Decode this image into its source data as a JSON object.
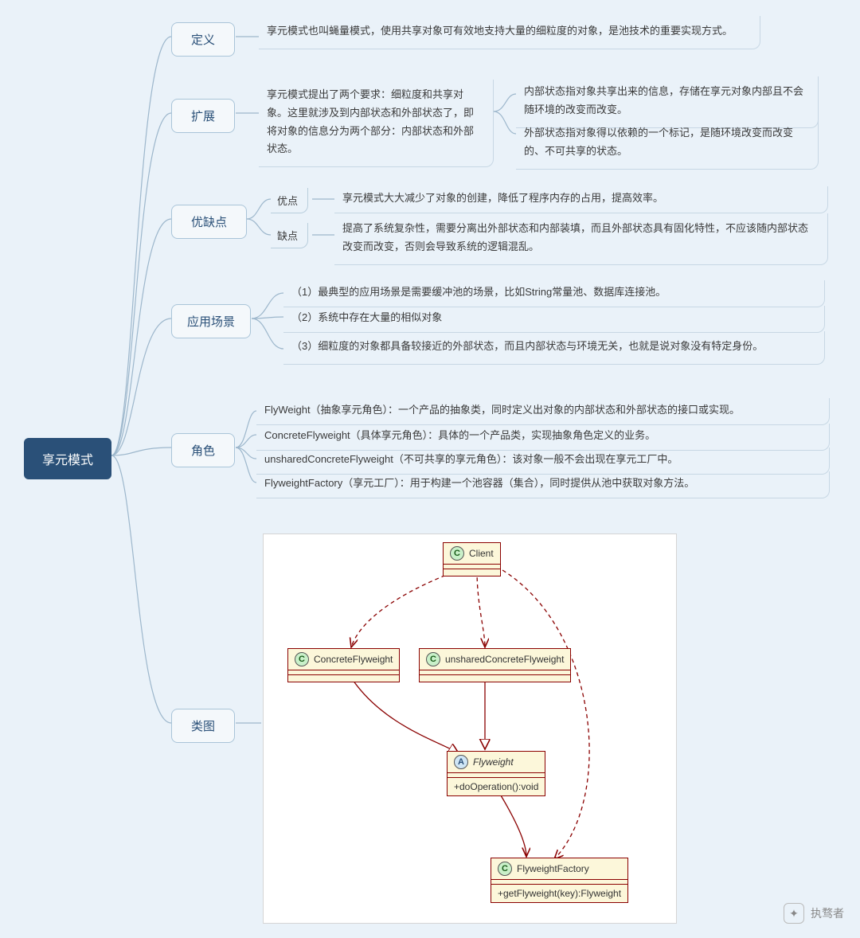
{
  "root": "享元模式",
  "branches": {
    "definition": {
      "label": "定义",
      "text": "享元模式也叫蝇量模式，使用共享对象可有效地支持大量的细粒度的对象，是池技术的重要实现方式。"
    },
    "extension": {
      "label": "扩展",
      "text": "享元模式提出了两个要求：细粒度和共享对象。这里就涉及到内部状态和外部状态了，即将对象的信息分为两个部分：内部状态和外部状态。",
      "inner": "内部状态指对象共享出来的信息，存储在享元对象内部且不会随环境的改变而改变。",
      "outer": "外部状态指对象得以依赖的一个标记，是随环境改变而改变的、不可共享的状态。"
    },
    "proscons": {
      "label": "优缺点",
      "pro_label": "优点",
      "con_label": "缺点",
      "pro": "享元模式大大减少了对象的创建，降低了程序内存的占用，提高效率。",
      "con": "提高了系统复杂性，需要分离出外部状态和内部装填，而且外部状态具有固化特性，不应该随内部状态改变而改变，否则会导致系统的逻辑混乱。"
    },
    "scenario": {
      "label": "应用场景",
      "items": [
        "（1）最典型的应用场景是需要缓冲池的场景，比如String常量池、数据库连接池。",
        "（2）系统中存在大量的相似对象",
        "（3）细粒度的对象都具备较接近的外部状态，而且内部状态与环境无关，也就是说对象没有特定身份。"
      ]
    },
    "roles": {
      "label": "角色",
      "items": [
        "FlyWeight（抽象享元角色）：一个产品的抽象类，同时定义出对象的内部状态和外部状态的接口或实现。",
        "ConcreteFlyweight（具体享元角色）：具体的一个产品类，实现抽象角色定义的业务。",
        "unsharedConcreteFlyweight（不可共享的享元角色）：该对象一般不会出现在享元工厂中。",
        "FlyweightFactory（享元工厂）：用于构建一个池容器（集合），同时提供从池中获取对象方法。"
      ]
    },
    "diagram": {
      "label": "类图"
    }
  },
  "uml": {
    "client": "Client",
    "concrete": "ConcreteFlyweight",
    "unshared": "unsharedConcreteFlyweight",
    "flyweight": "Flyweight",
    "flyweight_method": "+doOperation():void",
    "factory": "FlyweightFactory",
    "factory_method": "+getFlyweight(key):Flyweight"
  },
  "watermark": "执骛者"
}
